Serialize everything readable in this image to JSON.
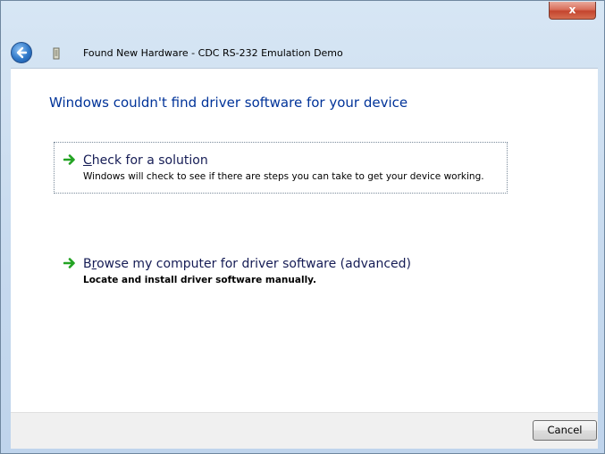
{
  "window": {
    "close_symbol": "x",
    "title": "Found New Hardware - CDC RS-232 Emulation Demo"
  },
  "content": {
    "heading": "Windows couldn't find driver software for your device",
    "options": [
      {
        "title_accesskey": "C",
        "title_rest": "heck for a solution",
        "description": "Windows will check to see if there are steps you can take to get your device working."
      },
      {
        "title_prefix": "B",
        "title_accesskey": "r",
        "title_rest": "owse my computer for driver software (advanced)",
        "description": "Locate and install driver software manually."
      }
    ]
  },
  "footer": {
    "cancel_label": "Cancel"
  },
  "colors": {
    "heading": "#003399",
    "option_title": "#151c55",
    "arrow_green": "#23a323"
  },
  "icons": [
    "back-arrow-icon",
    "hardware-device-icon",
    "green-arrow-icon",
    "close-icon"
  ]
}
